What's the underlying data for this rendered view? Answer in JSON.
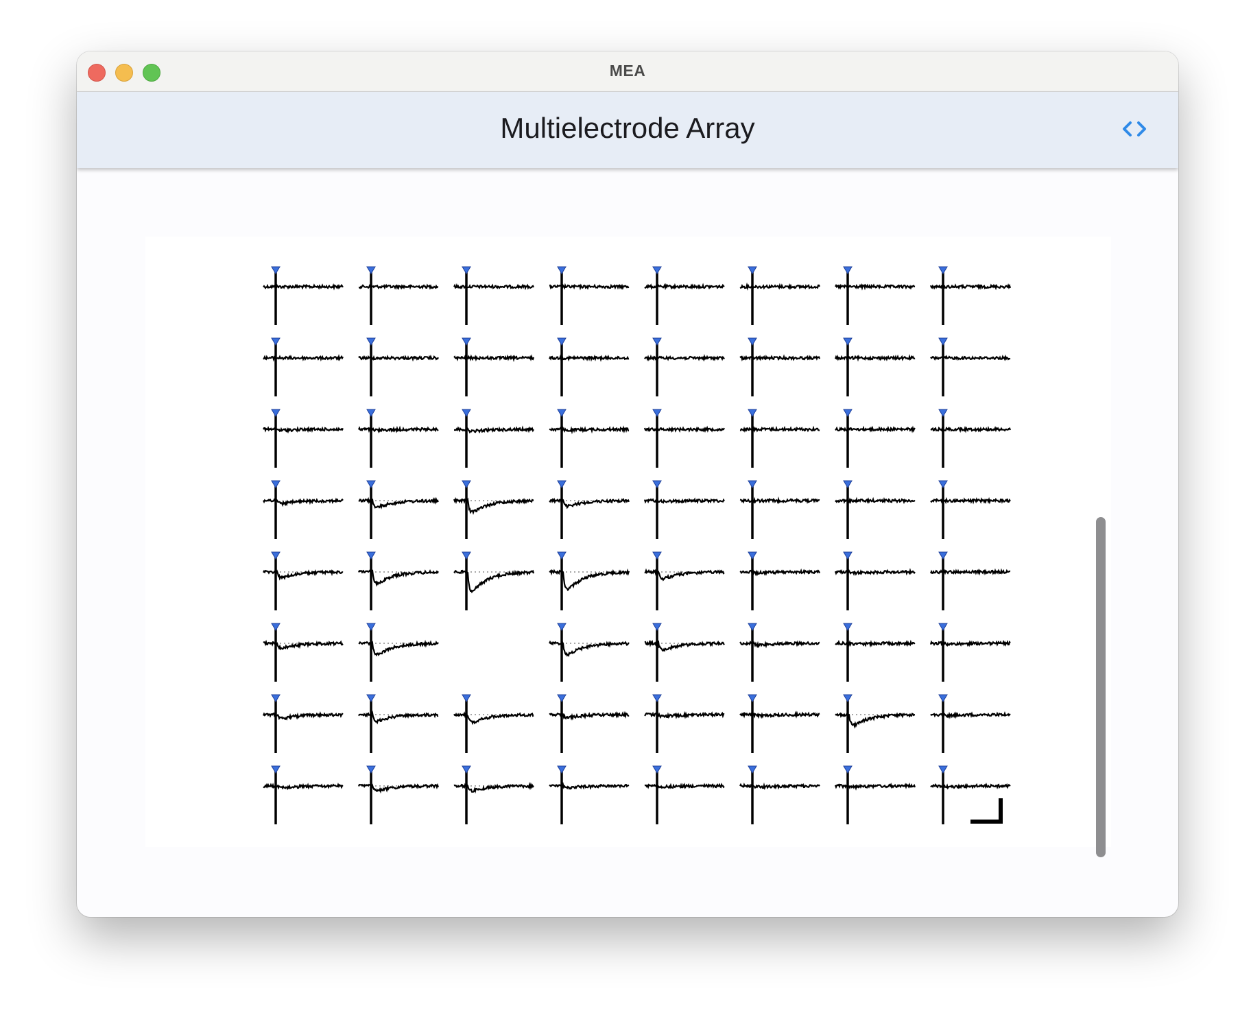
{
  "window": {
    "title": "MEA"
  },
  "header": {
    "title": "Multielectrode Array",
    "code_toggle_icon": "code-brackets-icon"
  },
  "colors": {
    "trace": "#000000",
    "stimulus_marker": "#3a6fdc",
    "accent": "#2f8ae8",
    "baseline": "#888888"
  },
  "chart_data": {
    "type": "line",
    "title": "",
    "layout": "8x8 electrode grid",
    "rows": 8,
    "cols": 8,
    "stimulus_marker": "triangle",
    "scale_bar": true,
    "baseline_dotted": true,
    "missing_electrodes": [
      [
        5,
        2
      ]
    ],
    "response_amplitude": [
      [
        0.0,
        0.0,
        0.0,
        0.0,
        0.0,
        0.0,
        0.0,
        0.0
      ],
      [
        0.0,
        0.0,
        0.0,
        0.0,
        0.0,
        0.0,
        0.0,
        0.0
      ],
      [
        0.05,
        0.05,
        0.1,
        0.05,
        0.0,
        0.0,
        0.0,
        0.0
      ],
      [
        0.15,
        0.35,
        0.6,
        0.3,
        0.05,
        0.0,
        0.0,
        0.0
      ],
      [
        0.3,
        0.6,
        1.0,
        0.9,
        0.35,
        0.05,
        0.05,
        0.0
      ],
      [
        0.25,
        0.6,
        null,
        0.6,
        0.35,
        0.1,
        0.05,
        0.05
      ],
      [
        0.2,
        0.35,
        0.4,
        0.15,
        0.1,
        0.05,
        0.55,
        0.05
      ],
      [
        0.1,
        0.25,
        0.25,
        0.1,
        0.05,
        0.05,
        0.05,
        0.05
      ]
    ]
  }
}
